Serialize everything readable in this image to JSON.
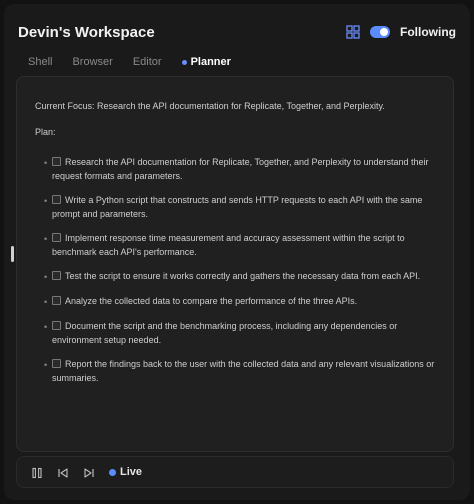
{
  "header": {
    "title": "Devin's Workspace",
    "following_label": "Following",
    "following_on": true
  },
  "tabs": [
    {
      "label": "Shell",
      "active": false
    },
    {
      "label": "Browser",
      "active": false
    },
    {
      "label": "Editor",
      "active": false
    },
    {
      "label": "Planner",
      "active": true
    }
  ],
  "planner": {
    "focus": "Current Focus: Research the API documentation for Replicate, Together, and Perplexity.",
    "plan_label": "Plan:",
    "items": [
      {
        "text": "Research the API documentation for Replicate, Together, and Perplexity to understand their request formats and parameters.",
        "checked": false
      },
      {
        "text": "Write a Python script that constructs and sends HTTP requests to each API with the same prompt and parameters.",
        "checked": false
      },
      {
        "text": "Implement response time measurement and accuracy assessment within the script to benchmark each API's performance.",
        "checked": false
      },
      {
        "text": "Test the script to ensure it works correctly and gathers the necessary data from each API.",
        "checked": false
      },
      {
        "text": "Analyze the collected data to compare the performance of the three APIs.",
        "checked": false
      },
      {
        "text": "Document the script and the benchmarking process, including any dependencies or environment setup needed.",
        "checked": false
      },
      {
        "text": "Report the findings back to the user with the collected data and any relevant visualizations or summaries.",
        "checked": false
      }
    ]
  },
  "controls": {
    "live_label": "Live",
    "icons": [
      "pause-icon",
      "skip-back-icon",
      "skip-forward-icon"
    ]
  },
  "colors": {
    "accent": "#5b8cff",
    "background": "#121212",
    "panel": "#202020"
  }
}
